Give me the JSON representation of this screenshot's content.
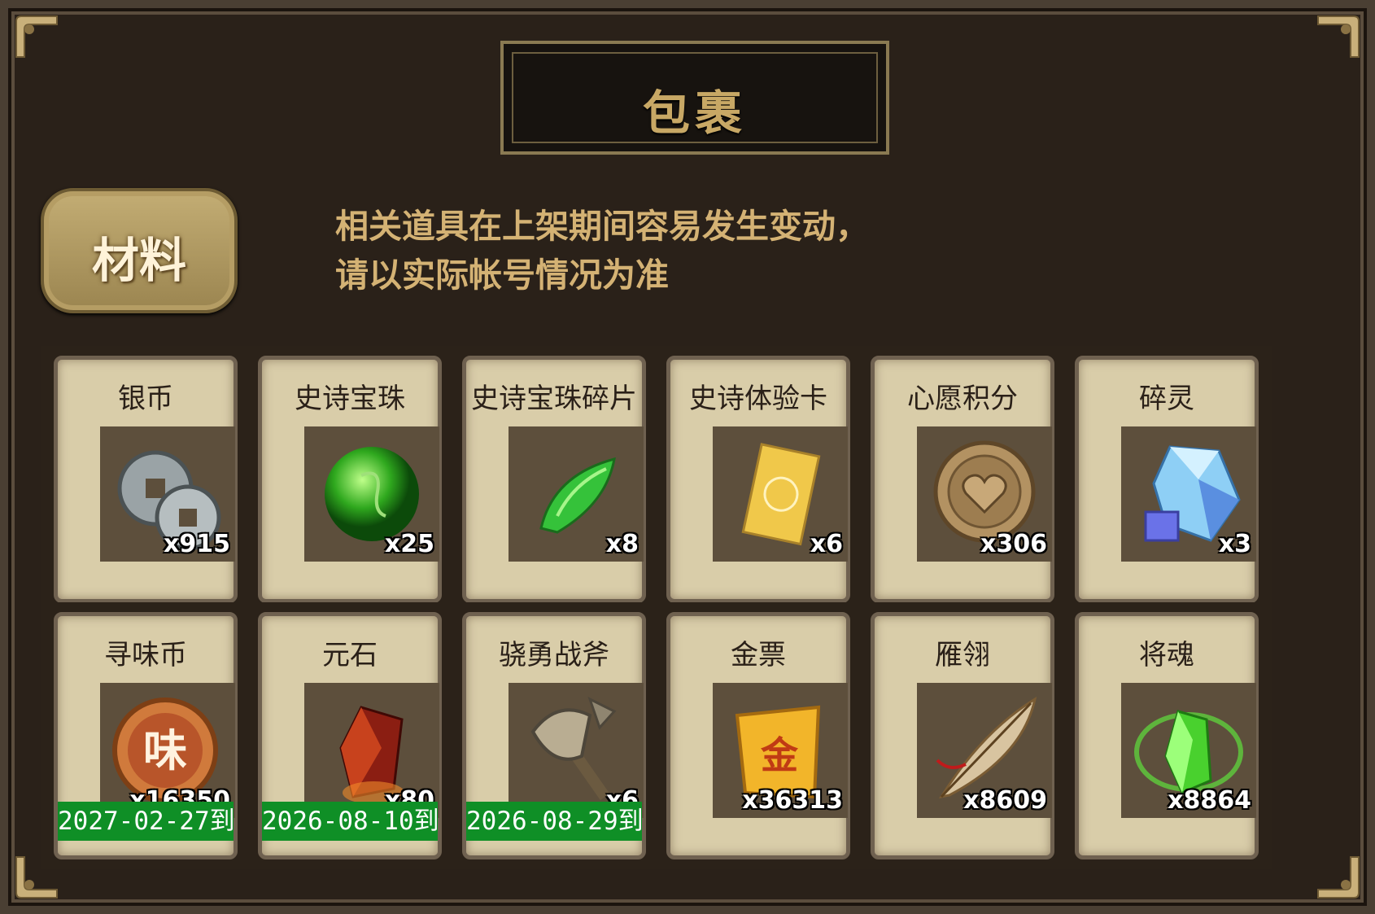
{
  "panel": {
    "title": "包裹",
    "tab_label": "材料",
    "notice_line1": "相关道具在上架期间容易发生变动，",
    "notice_line2": "请以实际帐号情况为准"
  },
  "items": [
    {
      "name": "银币",
      "count": "x915",
      "icon": "silver-coins-icon",
      "expiry": ""
    },
    {
      "name": "史诗宝珠",
      "count": "x25",
      "icon": "green-orb-icon",
      "expiry": ""
    },
    {
      "name": "史诗宝珠碎片",
      "count": "x8",
      "icon": "green-shard-icon",
      "expiry": ""
    },
    {
      "name": "史诗体验卡",
      "count": "x6",
      "icon": "gold-card-icon",
      "expiry": ""
    },
    {
      "name": "心愿积分",
      "count": "x306",
      "icon": "heart-coin-icon",
      "expiry": ""
    },
    {
      "name": "碎灵",
      "count": "x3",
      "icon": "blue-crystal-icon",
      "expiry": ""
    },
    {
      "name": "寻味币",
      "count": "x16350",
      "icon": "taste-coin-icon",
      "expiry": "2027-02-27到期"
    },
    {
      "name": "元石",
      "count": "x80",
      "icon": "red-stone-icon",
      "expiry": "2026-08-10到期"
    },
    {
      "name": "骁勇战斧",
      "count": "x6",
      "icon": "battle-axe-icon",
      "expiry": "2026-08-29到期"
    },
    {
      "name": "金票",
      "count": "x36313",
      "icon": "gold-scroll-icon",
      "expiry": ""
    },
    {
      "name": "雁翎",
      "count": "x8609",
      "icon": "feather-icon",
      "expiry": ""
    },
    {
      "name": "将魂",
      "count": "x8864",
      "icon": "general-soul-icon",
      "expiry": ""
    }
  ],
  "colors": {
    "accent": "#c8a865",
    "expiry_bar": "#0f8f26",
    "card": "#d9cda9"
  }
}
